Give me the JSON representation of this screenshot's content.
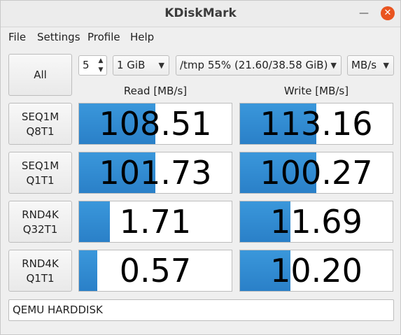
{
  "window": {
    "title": "KDiskMark",
    "minimize_icon": "minimize-icon",
    "close_icon": "close-icon",
    "close_color": "#e95420"
  },
  "menu": [
    "File",
    "Settings",
    "Profile",
    "Help"
  ],
  "toolbar": {
    "all_label": "All",
    "loops": "5",
    "file_size": "1 GiB",
    "target": "/tmp 55% (21.60/38.58 GiB)",
    "unit": "MB/s"
  },
  "columns": {
    "read": "Read [MB/s]",
    "write": "Write [MB/s]"
  },
  "tests": [
    {
      "line1": "SEQ1M",
      "line2": "Q8T1",
      "read": "108.51",
      "read_fill": 0.5,
      "write": "113.16",
      "write_fill": 0.5
    },
    {
      "line1": "SEQ1M",
      "line2": "Q1T1",
      "read": "101.73",
      "read_fill": 0.5,
      "write": "100.27",
      "write_fill": 0.5
    },
    {
      "line1": "RND4K",
      "line2": "Q32T1",
      "read": "1.71",
      "read_fill": 0.2,
      "write": "11.69",
      "write_fill": 0.33
    },
    {
      "line1": "RND4K",
      "line2": "Q1T1",
      "read": "0.57",
      "read_fill": 0.12,
      "write": "10.20",
      "write_fill": 0.33
    }
  ],
  "device": "QEMU HARDDISK",
  "colors": {
    "bar": "#2a80c8"
  }
}
